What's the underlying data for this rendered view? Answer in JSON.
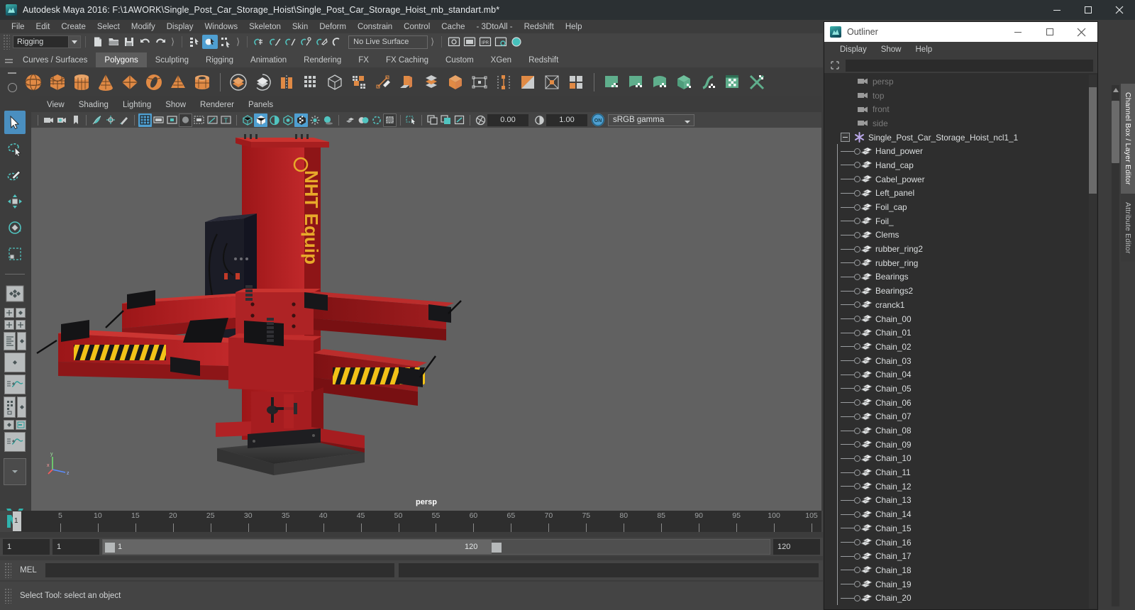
{
  "window": {
    "title": "Autodesk Maya 2016: F:\\1AWORK\\Single_Post_Car_Storage_Hoist\\Single_Post_Car_Storage_Hoist_mb_standart.mb*",
    "minimize_label": "–",
    "maximize_label": "❑",
    "close_label": "✕"
  },
  "menubar": {
    "items": [
      {
        "label": "File"
      },
      {
        "label": "Edit"
      },
      {
        "label": "Create"
      },
      {
        "label": "Select"
      },
      {
        "label": "Modify"
      },
      {
        "label": "Display"
      },
      {
        "label": "Windows"
      },
      {
        "label": "Skeleton"
      },
      {
        "label": "Skin"
      },
      {
        "label": "Deform"
      },
      {
        "label": "Constrain"
      },
      {
        "label": "Control"
      },
      {
        "label": "Cache"
      },
      {
        "label": "- 3DtoAll -"
      },
      {
        "label": "Redshift"
      },
      {
        "label": "Help"
      }
    ]
  },
  "statusline": {
    "menuset": "Rigging",
    "live_surface": "No Live Surface"
  },
  "shelf": {
    "tabs": [
      {
        "label": "Curves / Surfaces",
        "active": false
      },
      {
        "label": "Polygons",
        "active": true
      },
      {
        "label": "Sculpting",
        "active": false
      },
      {
        "label": "Rigging",
        "active": false
      },
      {
        "label": "Animation",
        "active": false
      },
      {
        "label": "Rendering",
        "active": false
      },
      {
        "label": "FX",
        "active": false
      },
      {
        "label": "FX Caching",
        "active": false
      },
      {
        "label": "Custom",
        "active": false
      },
      {
        "label": "XGen",
        "active": false
      },
      {
        "label": "Redshift",
        "active": false
      }
    ]
  },
  "viewport": {
    "menus": [
      {
        "label": "View"
      },
      {
        "label": "Shading"
      },
      {
        "label": "Lighting"
      },
      {
        "label": "Show"
      },
      {
        "label": "Renderer"
      },
      {
        "label": "Panels"
      }
    ],
    "exposure": "0.00",
    "gamma": "1.00",
    "view_transform_toggle": "ON",
    "view_transform": "sRGB gamma",
    "camera_label": "persp",
    "axis_labels": {
      "x": "x",
      "y": "y",
      "z": "z"
    },
    "model_text": "NHT Equip"
  },
  "timeline": {
    "tick_labels": [
      "5",
      "10",
      "15",
      "20",
      "25",
      "30",
      "35",
      "40",
      "45",
      "50",
      "55",
      "60",
      "65",
      "70",
      "75",
      "80",
      "85",
      "90",
      "95",
      "100",
      "105"
    ],
    "current_frame": "1",
    "start_field": "1",
    "end_field": "1",
    "range_start": "1",
    "range_end": "120",
    "playback_end": "120"
  },
  "command_line": {
    "language_label": "MEL",
    "input_value": "",
    "output_value": ""
  },
  "status_bar": {
    "help_text": "Select Tool: select an object"
  },
  "right_dock": {
    "tabs": [
      {
        "label": "Channel Box / Layer Editor",
        "active": true
      },
      {
        "label": "Attribute Editor",
        "active": false
      }
    ]
  },
  "outliner": {
    "title": "Outliner",
    "minimize_label": "–",
    "maximize_label": "□",
    "close_label": "✕",
    "menus": [
      {
        "label": "Display"
      },
      {
        "label": "Show"
      },
      {
        "label": "Help"
      }
    ],
    "search_value": "",
    "items": [
      {
        "name": "persp",
        "type": "camera"
      },
      {
        "name": "top",
        "type": "camera"
      },
      {
        "name": "front",
        "type": "camera"
      },
      {
        "name": "side",
        "type": "camera"
      },
      {
        "name": "Single_Post_Car_Storage_Hoist_ncl1_1",
        "type": "group"
      },
      {
        "name": "Hand_power",
        "type": "mesh"
      },
      {
        "name": "Hand_cap",
        "type": "mesh"
      },
      {
        "name": "Cabel_power",
        "type": "mesh"
      },
      {
        "name": "Left_panel",
        "type": "mesh"
      },
      {
        "name": "Foil_cap",
        "type": "mesh"
      },
      {
        "name": "Foil_",
        "type": "mesh"
      },
      {
        "name": "Clems",
        "type": "mesh"
      },
      {
        "name": "rubber_ring2",
        "type": "mesh"
      },
      {
        "name": "rubber_ring",
        "type": "mesh"
      },
      {
        "name": "Bearings",
        "type": "mesh"
      },
      {
        "name": "Bearings2",
        "type": "mesh"
      },
      {
        "name": "cranck1",
        "type": "mesh"
      },
      {
        "name": "Chain_00",
        "type": "mesh"
      },
      {
        "name": "Chain_01",
        "type": "mesh"
      },
      {
        "name": "Chain_02",
        "type": "mesh"
      },
      {
        "name": "Chain_03",
        "type": "mesh"
      },
      {
        "name": "Chain_04",
        "type": "mesh"
      },
      {
        "name": "Chain_05",
        "type": "mesh"
      },
      {
        "name": "Chain_06",
        "type": "mesh"
      },
      {
        "name": "Chain_07",
        "type": "mesh"
      },
      {
        "name": "Chain_08",
        "type": "mesh"
      },
      {
        "name": "Chain_09",
        "type": "mesh"
      },
      {
        "name": "Chain_10",
        "type": "mesh"
      },
      {
        "name": "Chain_11",
        "type": "mesh"
      },
      {
        "name": "Chain_12",
        "type": "mesh"
      },
      {
        "name": "Chain_13",
        "type": "mesh"
      },
      {
        "name": "Chain_14",
        "type": "mesh"
      },
      {
        "name": "Chain_15",
        "type": "mesh"
      },
      {
        "name": "Chain_16",
        "type": "mesh"
      },
      {
        "name": "Chain_17",
        "type": "mesh"
      },
      {
        "name": "Chain_18",
        "type": "mesh"
      },
      {
        "name": "Chain_19",
        "type": "mesh"
      },
      {
        "name": "Chain_20",
        "type": "mesh"
      }
    ]
  },
  "colors": {
    "accent_blue": "#4f9fd1",
    "shelf_orange": "#e08a45",
    "uv_green": "#5fae8c",
    "maya_teal": "#2fb3ad",
    "model_red": "#b41f21",
    "hazard_yellow": "#f2c218",
    "panel_bg": "#3c3c3c",
    "viewport_bg": "#616161"
  }
}
